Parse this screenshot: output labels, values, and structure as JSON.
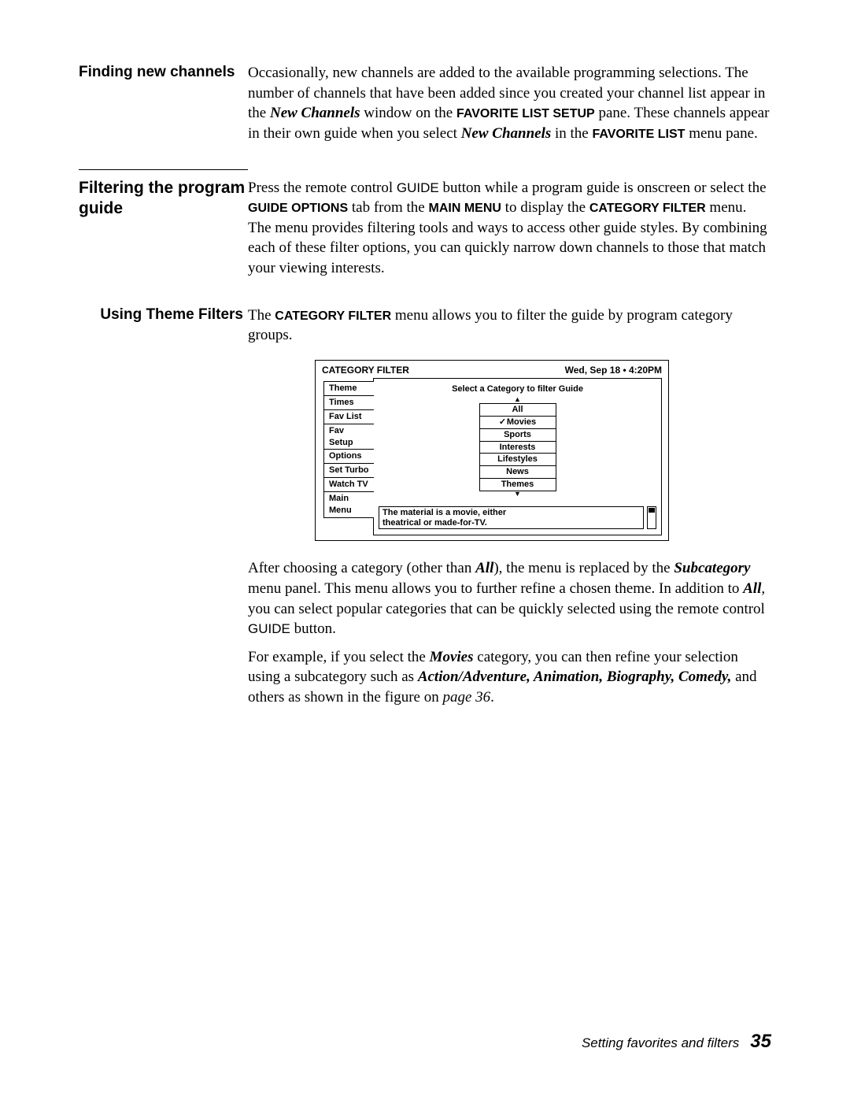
{
  "section1": {
    "heading": "Finding new channels",
    "p_before_nc": "Occasionally, new channels are added to the available programming selections. The number of channels that have been added since you created your channel list appear in the ",
    "nc_italic": "New Channels",
    "p_mid1": " window on the ",
    "fav_setup": "FAVORITE LIST SETUP",
    "p_mid2": " pane. These channels appear in their own guide when you select ",
    "nc_italic2": "New Channels",
    "p_mid3": " in the ",
    "fav_list": "FAVORITE LIST",
    "p_end": " menu pane."
  },
  "section2": {
    "heading": "Filtering the program guide",
    "p_a": "Press the remote control ",
    "guide_sans1": "GUIDE",
    "p_b": " button while a program guide is onscreen or select the ",
    "guide_opts": "GUIDE OPTIONS",
    "p_c": " tab from the ",
    "main_menu": "MAIN MENU",
    "p_d": " to display the ",
    "cat_filter": "CATEGORY FILTER",
    "p_e": " menu. The menu provides filtering tools and ways to access other guide styles. By combining each of these filter options, you can quickly narrow down channels to those that match your viewing interests."
  },
  "section3": {
    "heading": "Using Theme Filters",
    "p_a": "The ",
    "cat_filter": "CATEGORY FILTER",
    "p_b": " menu allows you to filter the guide by program category groups."
  },
  "figure": {
    "title": "CATEGORY FILTER",
    "datetime": "Wed, Sep 18  •  4:20PM",
    "tabs": [
      "Theme",
      "Times",
      "Fav List",
      "Fav Setup",
      "Options",
      "Set Turbo",
      "Watch TV",
      "Main Menu"
    ],
    "panel_title": "Select a Category to filter Guide",
    "categories": [
      "All",
      "Movies",
      "Sports",
      "Interests",
      "Lifestyles",
      "News",
      "Themes"
    ],
    "selected": "Movies",
    "description_l1": "The material is a movie, either",
    "description_l2": "theatrical or made-for-TV."
  },
  "after1": {
    "p_a": "After choosing a category (other than ",
    "all": "All",
    "p_b": "), the menu is replaced by the ",
    "subcat": "Subcategory",
    "p_c": " menu panel. This menu allows you to further refine a chosen theme. In addition to ",
    "all2": "All",
    "p_d": ", you can select popular categories that can be quickly selected using the remote control ",
    "guide_sans": "GUIDE",
    "p_e": " button."
  },
  "after2": {
    "p_a": "For example, if you select the ",
    "movies": "Movies",
    "p_b": " category, you can then refine your selection using a subcategory such as ",
    "subs": "Action/Adventure, Animation, Biography, Comedy,",
    "p_c": " and others as shown in the figure on ",
    "pageref": "page 36",
    "p_d": "."
  },
  "footer": {
    "text": "Setting favorites and filters",
    "number": "35"
  }
}
